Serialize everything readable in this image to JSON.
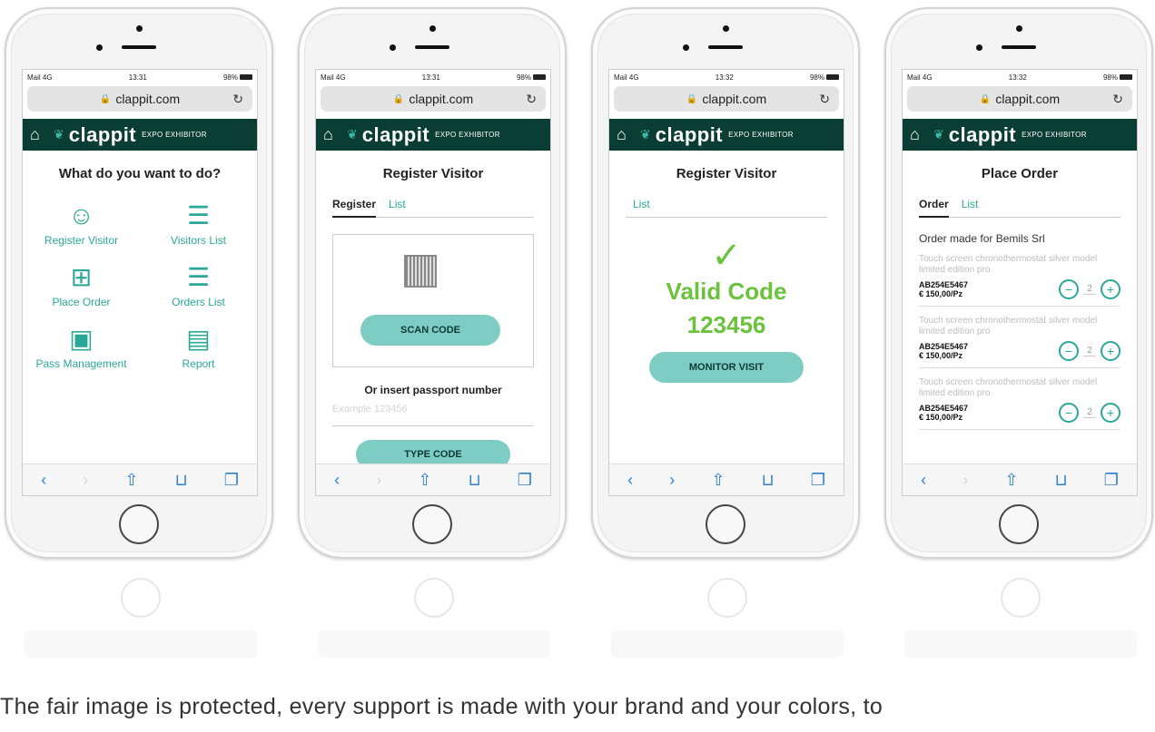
{
  "phones": {
    "common": {
      "status_carrier": "Mail",
      "status_network": "4G",
      "status_battery": "98%",
      "url": "clappit.com",
      "brand": "clappit",
      "brand_sub": "EXPO EXHIBITOR",
      "accent": "#2aa897",
      "appbar_color": "#0a3d34",
      "valid_color": "#6bc23c"
    },
    "p1": {
      "time": "13:31",
      "title": "What do you want to do?",
      "items": [
        {
          "label": "Register Visitor",
          "icon": "add-user-icon"
        },
        {
          "label": "Visitors List",
          "icon": "visitors-list-icon"
        },
        {
          "label": "Place Order",
          "icon": "cart-add-icon"
        },
        {
          "label": "Orders List",
          "icon": "orders-list-icon"
        },
        {
          "label": "Pass Management",
          "icon": "pass-icon"
        },
        {
          "label": "Report",
          "icon": "report-icon"
        }
      ]
    },
    "p2": {
      "time": "13:31",
      "title": "Register Visitor",
      "tab_active": "Register",
      "tab_other": "List",
      "scan_button": "SCAN CODE",
      "pass_label": "Or insert passport number",
      "pass_placeholder": "Example 123456",
      "type_button": "TYPE CODE"
    },
    "p3": {
      "time": "13:32",
      "title": "Register Visitor",
      "tab_active": "List",
      "valid_text": "Valid Code",
      "code": "123456",
      "monitor_button": "MONITOR VISIT"
    },
    "p4": {
      "time": "13:32",
      "title": "Place Order",
      "tab_active": "Order",
      "tab_other": "List",
      "order_for": "Order made for Bemils Srl",
      "products": [
        {
          "name": "Touch screen chronothermostat silver model limited edition pro",
          "code": "AB254E5467",
          "price": "€ 150,00/Pz",
          "qty": "2"
        },
        {
          "name": "Touch screen chronothermostat silver model limited edition pro",
          "code": "AB254E5467",
          "price": "€ 150,00/Pz",
          "qty": "2"
        },
        {
          "name": "Touch screen chronothermostat silver model limited edition pro",
          "code": "AB254E5467",
          "price": "€ 150,00/Pz",
          "qty": "2"
        }
      ]
    }
  },
  "caption": "The fair image is protected, every support is made with your brand and your colors, to"
}
